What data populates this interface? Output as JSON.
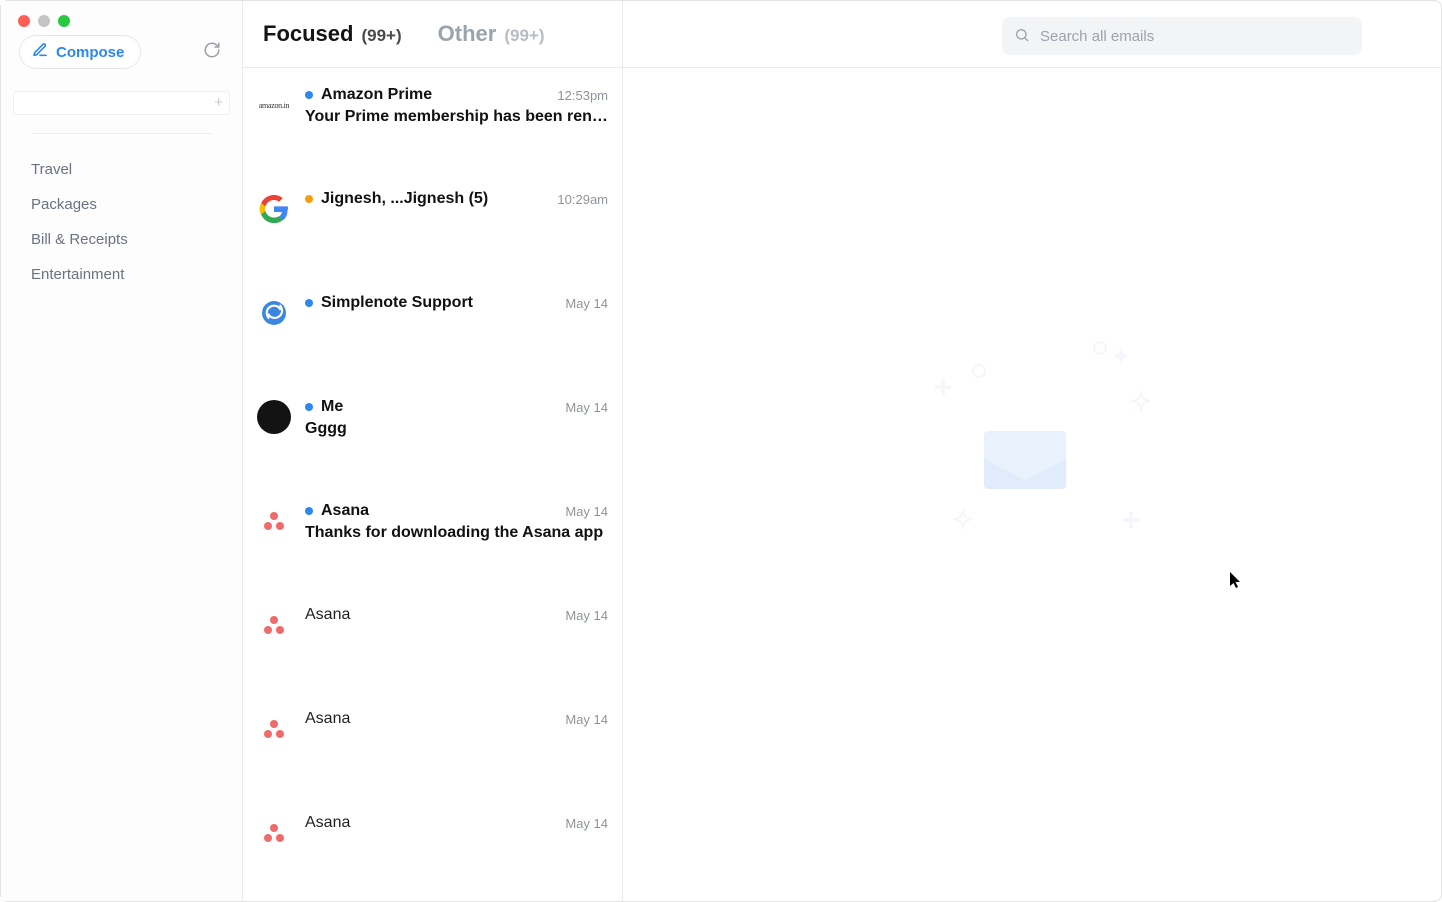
{
  "sidebar": {
    "compose_label": "Compose",
    "folders": [
      "Travel",
      "Packages",
      "Bill & Receipts",
      "Entertainment"
    ]
  },
  "tabs": {
    "focused": {
      "label": "Focused",
      "count": "(99+)"
    },
    "other": {
      "label": "Other",
      "count": "(99+)"
    }
  },
  "search": {
    "placeholder": "Search all emails"
  },
  "messages": [
    {
      "sender": "Amazon Prime",
      "subject": "Your Prime membership has been ren…",
      "time": "12:53pm",
      "unread": true,
      "dot": "blue",
      "avatar": "amazon"
    },
    {
      "sender": "Jignesh, ...Jignesh (5)",
      "subject": "",
      "time": "10:29am",
      "unread": true,
      "dot": "orange",
      "avatar": "google"
    },
    {
      "sender": "Simplenote Support",
      "subject": "",
      "time": "May 14",
      "unread": true,
      "dot": "blue",
      "avatar": "simplenote"
    },
    {
      "sender": "Me",
      "subject": "Gggg",
      "time": "May 14",
      "unread": true,
      "dot": "blue",
      "avatar": "dark"
    },
    {
      "sender": "Asana",
      "subject": "Thanks for downloading the Asana app",
      "time": "May 14",
      "unread": true,
      "dot": "blue",
      "avatar": "asana"
    },
    {
      "sender": "Asana",
      "subject": "",
      "time": "May 14",
      "unread": false,
      "dot": "",
      "avatar": "asana"
    },
    {
      "sender": "Asana",
      "subject": "",
      "time": "May 14",
      "unread": false,
      "dot": "",
      "avatar": "asana"
    },
    {
      "sender": "Asana",
      "subject": "",
      "time": "May 14",
      "unread": false,
      "dot": "",
      "avatar": "asana"
    }
  ]
}
